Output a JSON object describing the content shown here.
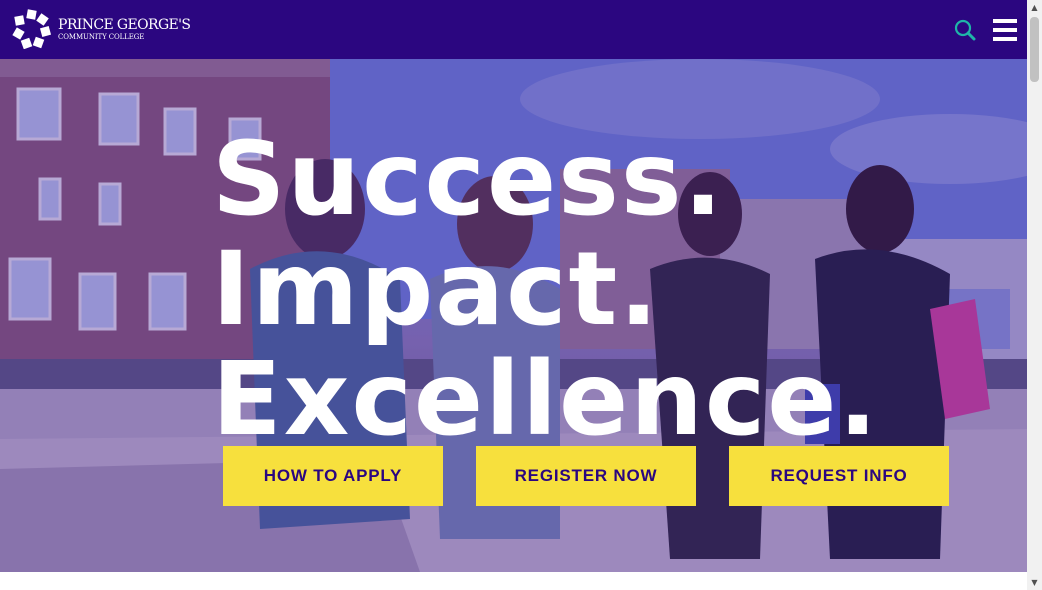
{
  "header": {
    "logo": {
      "line1": "PRINCE GEORGE'S",
      "line2": "COMMUNITY COLLEGE",
      "icon": "pgcc-logo-icon"
    },
    "search_icon": "search-icon",
    "menu_icon": "hamburger-menu-icon",
    "colors": {
      "background": "#2b0680",
      "search_accent": "#1fb5a8"
    }
  },
  "hero": {
    "headline": [
      "Success.",
      "Impact.",
      "Excellence."
    ],
    "buttons": [
      "HOW TO APPLY",
      "REGISTER NOW",
      "REQUEST INFO"
    ],
    "colors": {
      "button_bg": "#f7e03d",
      "button_text": "#2b0680",
      "headline": "#ffffff"
    }
  },
  "scrollbar": {
    "up_arrow": "▲",
    "down_arrow": "▼"
  }
}
